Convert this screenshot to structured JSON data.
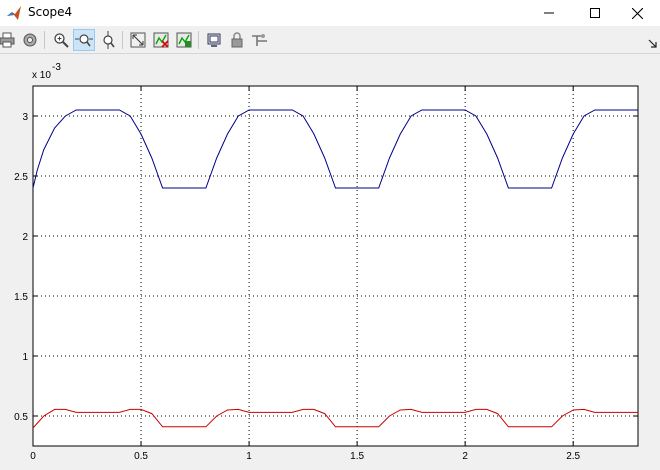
{
  "window": {
    "title": "Scope4",
    "minimize_icon": "minimize-icon",
    "maximize_icon": "maximize-icon",
    "close_icon": "close-icon"
  },
  "toolbar": {
    "items": [
      {
        "name": "print-icon"
      },
      {
        "name": "parameters-gear-icon"
      },
      {
        "name": "zoom-in-icon"
      },
      {
        "name": "zoom-x-axis-icon",
        "active": true
      },
      {
        "name": "zoom-y-axis-icon"
      },
      {
        "name": "autoscale-icon"
      },
      {
        "name": "save-axes-settings-icon"
      },
      {
        "name": "restore-axes-settings-icon"
      },
      {
        "name": "floating-scope-icon"
      },
      {
        "name": "lock-axes-icon"
      },
      {
        "name": "signal-selection-icon"
      }
    ],
    "dock_icon": "dock-arrow-icon"
  },
  "chart_data": {
    "type": "line",
    "exponent_label": "x 10",
    "exponent_power": "-3",
    "xlim": [
      0,
      2.8
    ],
    "ylim": [
      0.25,
      3.25
    ],
    "x_ticks": [
      0,
      0.5,
      1,
      1.5,
      2,
      2.5
    ],
    "x_tick_labels": [
      "0",
      "0.5",
      "1",
      "1.5",
      "2",
      "2.5"
    ],
    "y_ticks": [
      0.5,
      1,
      1.5,
      2,
      2.5,
      3
    ],
    "y_tick_labels": [
      "0.5",
      "1",
      "1.5",
      "2",
      "2.5",
      "3"
    ],
    "grid": true,
    "grid_style": "dotted",
    "series": [
      {
        "color": "#00008b",
        "x": [
          0,
          0.02,
          0.05,
          0.1,
          0.15,
          0.2,
          0.4,
          0.45,
          0.5,
          0.55,
          0.6,
          0.8,
          0.85,
          0.9,
          0.95,
          1.0,
          1.2,
          1.25,
          1.3,
          1.35,
          1.4,
          1.6,
          1.65,
          1.7,
          1.75,
          1.8,
          2.0,
          2.05,
          2.1,
          2.15,
          2.2,
          2.4,
          2.45,
          2.5,
          2.55,
          2.6,
          2.8
        ],
        "y": [
          2.4,
          2.55,
          2.72,
          2.9,
          3.0,
          3.05,
          3.05,
          3.0,
          2.85,
          2.65,
          2.4,
          2.4,
          2.65,
          2.85,
          3.0,
          3.05,
          3.05,
          3.0,
          2.85,
          2.65,
          2.4,
          2.4,
          2.65,
          2.85,
          3.0,
          3.05,
          3.05,
          3.0,
          2.85,
          2.65,
          2.4,
          2.4,
          2.65,
          2.85,
          3.0,
          3.05,
          3.05
        ]
      },
      {
        "color": "#cc0000",
        "x": [
          0,
          0.05,
          0.1,
          0.15,
          0.2,
          0.4,
          0.45,
          0.5,
          0.55,
          0.6,
          0.8,
          0.85,
          0.9,
          0.95,
          1.0,
          1.2,
          1.25,
          1.3,
          1.35,
          1.4,
          1.6,
          1.65,
          1.7,
          1.75,
          1.8,
          2.0,
          2.05,
          2.1,
          2.15,
          2.2,
          2.4,
          2.45,
          2.5,
          2.55,
          2.6,
          2.8
        ],
        "y": [
          0.4,
          0.5,
          0.555,
          0.555,
          0.53,
          0.53,
          0.555,
          0.555,
          0.52,
          0.41,
          0.41,
          0.5,
          0.55,
          0.555,
          0.53,
          0.53,
          0.555,
          0.555,
          0.52,
          0.41,
          0.41,
          0.5,
          0.55,
          0.555,
          0.53,
          0.53,
          0.555,
          0.555,
          0.52,
          0.41,
          0.41,
          0.5,
          0.55,
          0.555,
          0.53,
          0.53
        ]
      }
    ]
  }
}
